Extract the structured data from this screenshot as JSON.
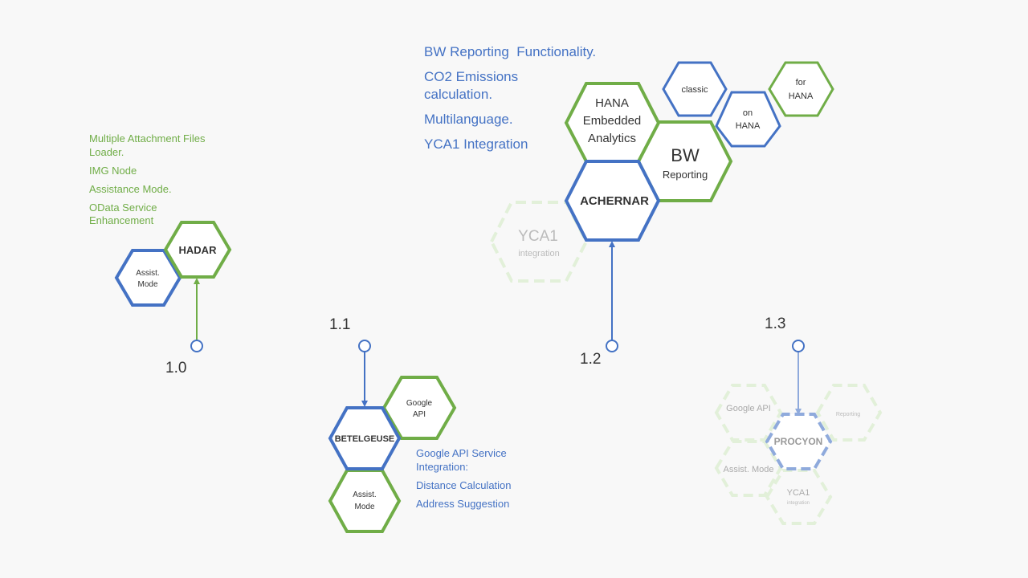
{
  "colors": {
    "blue": "#4472C4",
    "green": "#70AD47",
    "ghost_green": "#E2F0D9",
    "ghost_blue": "#8FAADC",
    "text_dark": "#333333",
    "text_ghost": "#AAAAAA",
    "background": "#F8F8F8"
  },
  "timeline": {
    "versions": [
      {
        "label": "1.0"
      },
      {
        "label": "1.1"
      },
      {
        "label": "1.2"
      },
      {
        "label": "1.3"
      }
    ]
  },
  "releases": {
    "hadar": {
      "name": "HADAR",
      "modules": [
        "Assist. Mode"
      ],
      "notes": [
        "Multiple Attachment Files Loader.",
        "IMG Node",
        "Assistance Mode.",
        "OData Service Enhancement"
      ]
    },
    "betelgeuse": {
      "name": "BETELGEUSE",
      "modules": [
        "Google API",
        "Assist. Mode"
      ],
      "notes": [
        "Google API Service Integration:",
        "Distance Calculation",
        "Address Suggestion"
      ]
    },
    "achernar": {
      "name": "ACHERNAR",
      "modules": [
        "HANA Embedded Analytics",
        "BW Reporting",
        "classic",
        "on HANA",
        "for HANA",
        "YCA1 integration"
      ],
      "bw_title": "BW",
      "bw_sub": "Reporting",
      "yca1_title": "YCA1",
      "yca1_sub": "integration",
      "notes": [
        "BW Reporting  Functionality.",
        "CO2 Emissions calculation.",
        "Multilanguage.",
        "YCA1 Integration"
      ]
    },
    "procyon": {
      "name": "PROCYON",
      "modules": [
        "Google API",
        "Reporting",
        "Assist. Mode",
        "YCA1 integration"
      ],
      "yca1_title": "YCA1",
      "yca1_sub": "integration"
    }
  }
}
